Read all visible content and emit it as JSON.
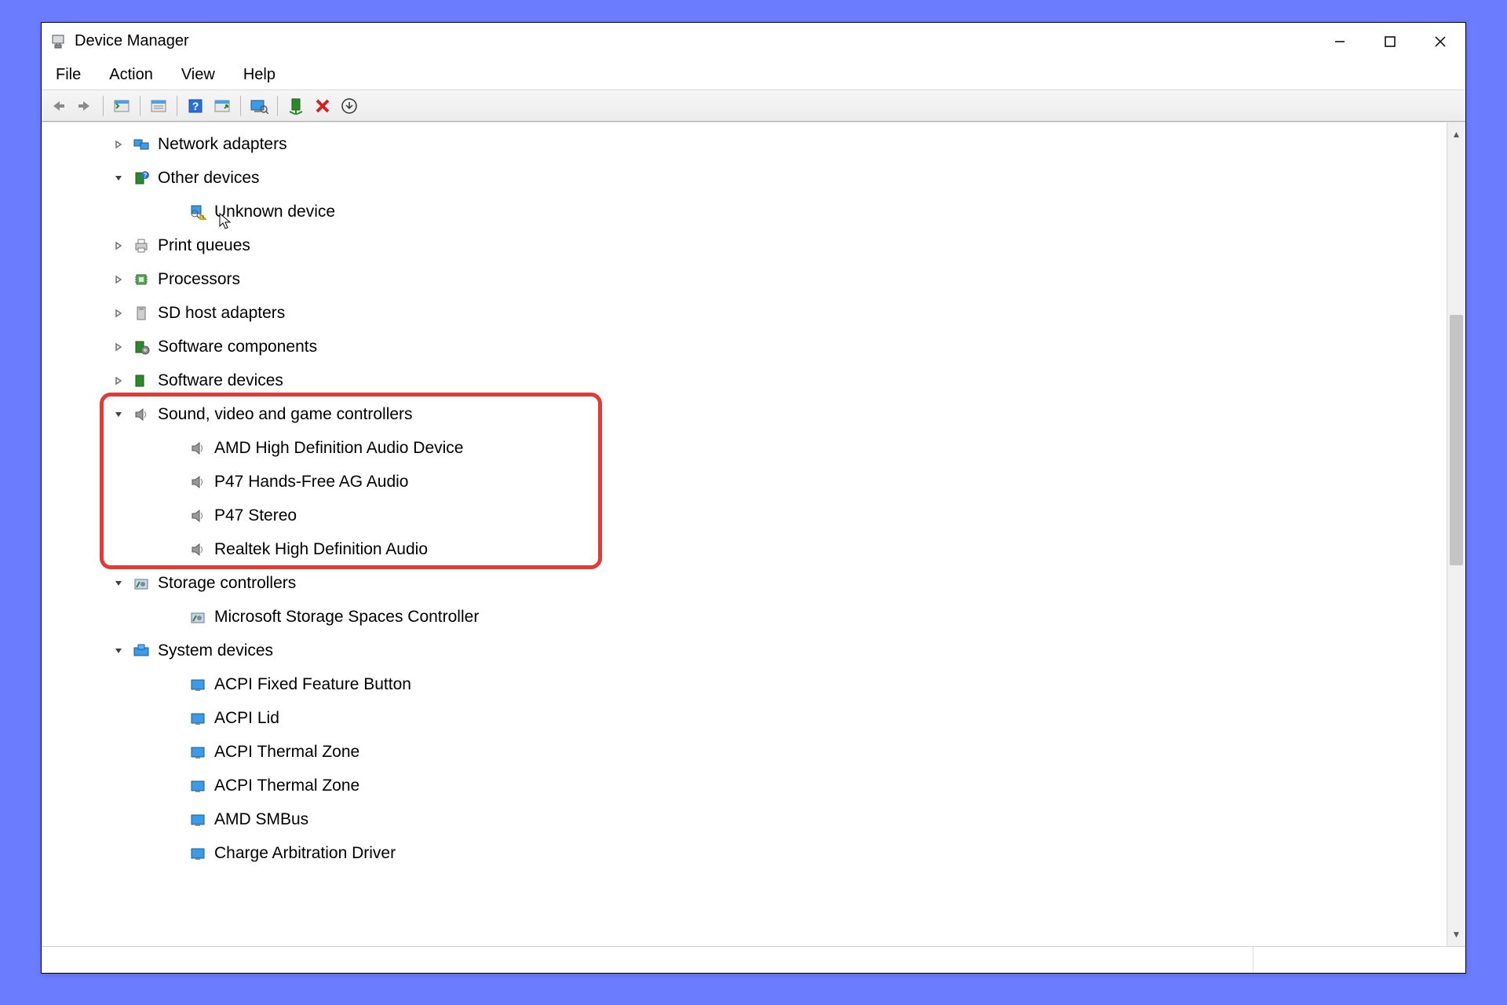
{
  "window": {
    "title": "Device Manager"
  },
  "menubar": {
    "file": "File",
    "action": "Action",
    "view": "View",
    "help": "Help"
  },
  "toolbar_icons": {
    "back": "back-arrow-icon",
    "forward": "forward-arrow-icon",
    "show_hidden": "show-hidden-icon",
    "properties": "properties-icon",
    "help": "help-icon",
    "action": "action-icon",
    "scan": "scan-hardware-icon",
    "enable": "enable-device-icon",
    "disable": "disable-device-icon",
    "uninstall": "uninstall-icon"
  },
  "tree": [
    {
      "label": "Network adapters",
      "icon": "network-icon",
      "expander": "collapsed"
    },
    {
      "label": "Other devices",
      "icon": "other-devices-icon",
      "expander": "expanded",
      "children": [
        {
          "label": "Unknown device",
          "icon": "unknown-device-icon"
        }
      ]
    },
    {
      "label": "Print queues",
      "icon": "printer-icon",
      "expander": "collapsed"
    },
    {
      "label": "Processors",
      "icon": "processor-icon",
      "expander": "collapsed"
    },
    {
      "label": "SD host adapters",
      "icon": "sd-icon",
      "expander": "collapsed"
    },
    {
      "label": "Software components",
      "icon": "software-component-icon",
      "expander": "collapsed"
    },
    {
      "label": "Software devices",
      "icon": "software-device-icon",
      "expander": "collapsed"
    },
    {
      "label": "Sound, video and game controllers",
      "icon": "sound-icon",
      "expander": "expanded",
      "highlighted": true,
      "children": [
        {
          "label": "AMD High Definition Audio Device",
          "icon": "speaker-icon"
        },
        {
          "label": "P47 Hands-Free AG Audio",
          "icon": "speaker-icon"
        },
        {
          "label": "P47 Stereo",
          "icon": "speaker-icon"
        },
        {
          "label": "Realtek High Definition Audio",
          "icon": "speaker-icon"
        }
      ]
    },
    {
      "label": "Storage controllers",
      "icon": "storage-icon",
      "expander": "expanded",
      "children": [
        {
          "label": "Microsoft Storage Spaces Controller",
          "icon": "storage-item-icon"
        }
      ]
    },
    {
      "label": "System devices",
      "icon": "system-device-icon",
      "expander": "expanded",
      "children": [
        {
          "label": "ACPI Fixed Feature Button",
          "icon": "system-item-icon"
        },
        {
          "label": "ACPI Lid",
          "icon": "system-item-icon"
        },
        {
          "label": "ACPI Thermal Zone",
          "icon": "system-item-icon"
        },
        {
          "label": "ACPI Thermal Zone",
          "icon": "system-item-icon"
        },
        {
          "label": "AMD SMBus",
          "icon": "system-item-icon"
        },
        {
          "label": "Charge Arbitration Driver",
          "icon": "system-item-icon"
        }
      ]
    }
  ]
}
